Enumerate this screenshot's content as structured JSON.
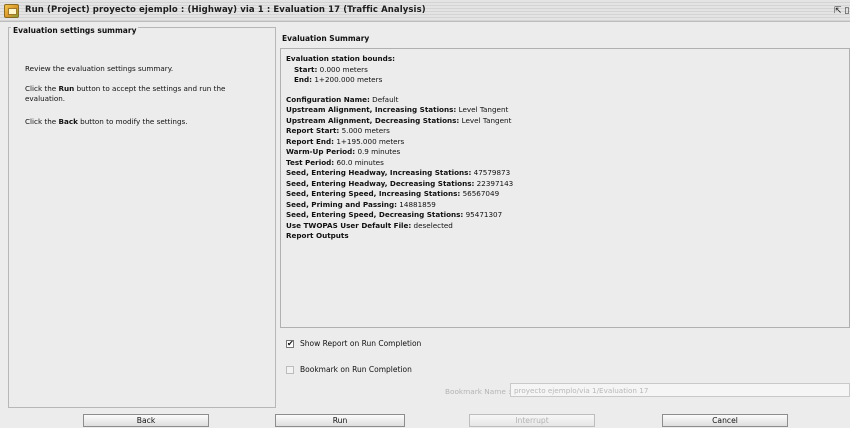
{
  "window": {
    "title": "Run (Project) proyecto ejemplo : (Highway) via 1 : Evaluation 17 (Traffic Analysis)",
    "restore_glyph": "⇱ ▯"
  },
  "left_panel": {
    "title": "Evaluation settings summary",
    "review_text": "Review the evaluation settings summary.",
    "run_pre": "Click the ",
    "run_word": "Run",
    "run_post": " button to accept the settings and run the evaluation.",
    "back_pre": "Click the ",
    "back_word": "Back",
    "back_post": " button to modify the settings."
  },
  "summary": {
    "label": "Evaluation Summary",
    "bounds_label": "Evaluation station bounds:",
    "start_label": "Start:",
    "start_value": "0.000 meters",
    "end_label": "End:",
    "end_value": "1+200.000 meters",
    "rows": [
      {
        "k": "Configuration Name:",
        "v": "Default"
      },
      {
        "k": "Upstream Alignment, Increasing Stations:",
        "v": "Level Tangent"
      },
      {
        "k": "Upstream Alignment, Decreasing Stations:",
        "v": "Level Tangent"
      },
      {
        "k": "Report Start:",
        "v": "5.000 meters"
      },
      {
        "k": "Report End:",
        "v": "1+195.000 meters"
      },
      {
        "k": "Warm-Up Period:",
        "v": "0.9 minutes"
      },
      {
        "k": "Test Period:",
        "v": "60.0 minutes"
      },
      {
        "k": "Seed, Entering Headway, Increasing Stations:",
        "v": "47579873"
      },
      {
        "k": "Seed, Entering Headway, Decreasing Stations:",
        "v": "22397143"
      },
      {
        "k": "Seed, Entering Speed, Increasing Stations:",
        "v": "56567049"
      },
      {
        "k": "Seed, Priming and Passing:",
        "v": "14881859"
      },
      {
        "k": "Seed, Entering Speed, Decreasing Stations:",
        "v": "95471307"
      },
      {
        "k": "Use TWOPAS User Default File:",
        "v": "deselected"
      },
      {
        "k": "Report Outputs",
        "v": ""
      }
    ]
  },
  "options": {
    "show_report": {
      "label": "Show Report on Run Completion",
      "checked": true,
      "check_glyph": "✔"
    },
    "bookmark": {
      "label": "Bookmark on Run Completion",
      "checked": false
    },
    "bookmark_name_label": "Bookmark Name :",
    "bookmark_name_value": "proyecto ejemplo/via 1/Evaluation 17"
  },
  "buttons": {
    "back": "Back",
    "run": "Run",
    "interrupt": "Interrupt",
    "cancel": "Cancel"
  }
}
